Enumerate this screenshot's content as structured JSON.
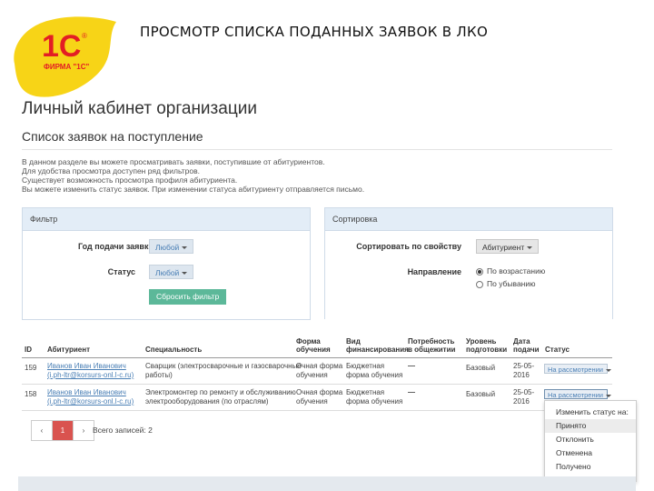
{
  "slide_title": "ПРОСМОТР СПИСКА ПОДАННЫХ ЗАЯВОК В ЛКО",
  "logo": {
    "mark": "1С",
    "caption": "ФИРМА \"1С\"",
    "registered": "®",
    "bg_color": "#f7d417",
    "accent_color": "#e31e24"
  },
  "page": {
    "cabinet_title": "Личный кабинет организации",
    "list_title": "Список заявок на поступление",
    "info_lines": [
      "В данном разделе вы можете просматривать заявки, поступившие от абитуриентов.",
      "Для удобства просмотра доступен ряд фильтров.",
      "Существует возможность просмотра профиля абитуриента.",
      "Вы можете изменить статус заявок. При изменении статуса абитуриенту отправляется письмо."
    ]
  },
  "filter": {
    "heading": "Фильтр",
    "year_label": "Год подачи заявки",
    "year_value": "Любой",
    "status_label": "Статус",
    "status_value": "Любой",
    "reset_label": "Сбросить фильтр"
  },
  "sort": {
    "heading": "Сортировка",
    "property_label": "Сортировать по свойству",
    "property_value": "Абитуриент",
    "direction_label": "Направление",
    "asc_label": "По возрастанию",
    "desc_label": "По убыванию"
  },
  "table": {
    "headers": {
      "id": "ID",
      "applicant": "Абитуриент",
      "specialty": "Специальность",
      "study_form": [
        "Форма",
        "обучения"
      ],
      "financing": [
        "Вид",
        "финансирования"
      ],
      "dorm": [
        "Потребность",
        "в общежитии"
      ],
      "level": [
        "Уровень",
        "подготовки"
      ],
      "date": [
        "Дата",
        "подачи"
      ],
      "status": "Статус"
    },
    "rows": [
      {
        "id": "159",
        "name": "Иванов Иван Иванович",
        "email": "(i.ph-ltr@korsurs-onl.l-c.ru)",
        "specialty": [
          "Сварщик (электросварочные и газосварочные",
          "работы)"
        ],
        "study_form": [
          "Очная форма",
          "обучения"
        ],
        "financing": [
          "Бюджетная",
          "форма обучения"
        ],
        "dorm": "—",
        "level": "Базовый",
        "date": [
          "25-05-",
          "2016"
        ],
        "status": "На рассмотрении"
      },
      {
        "id": "158",
        "name": "Иванов Иван Иванович",
        "email": "(i.ph-ltr@korsurs-onl.l-c.ru)",
        "specialty": [
          "Электромонтер по ремонту и обслуживанию",
          "электрооборудования (по отраслям)"
        ],
        "study_form": [
          "Очная форма",
          "обучения"
        ],
        "financing": [
          "Бюджетная",
          "форма обучения"
        ],
        "dorm": "—",
        "level": "Базовый",
        "date": [
          "25-05-",
          "2016"
        ],
        "status": "На рассмотрении"
      }
    ]
  },
  "status_menu": {
    "heading": "Изменить статус на:",
    "items": [
      "Принято",
      "Отклонить",
      "Отменена",
      "Получено"
    ]
  },
  "pager": {
    "prev": "‹",
    "page": "1",
    "next": "›",
    "total": "Всего записей: 2"
  }
}
